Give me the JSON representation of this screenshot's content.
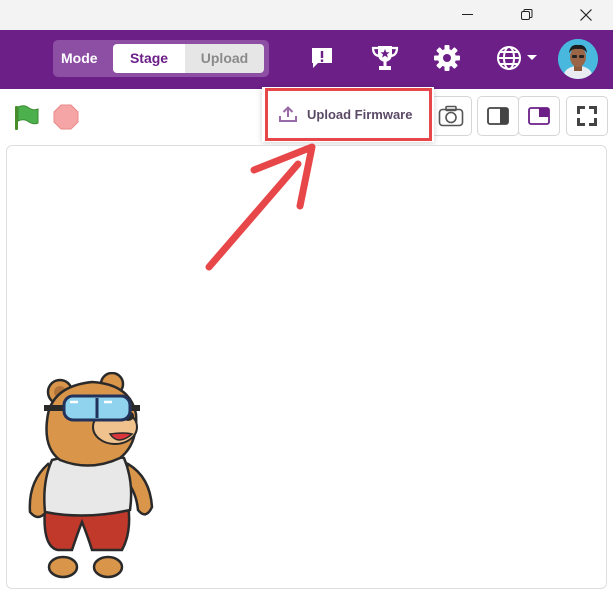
{
  "window": {
    "controls": [
      "minimize-icon",
      "restore-icon",
      "close-icon"
    ]
  },
  "header": {
    "mode_label": "Mode",
    "mode_options": [
      "Stage",
      "Upload"
    ],
    "selected_mode": "Stage",
    "icons": [
      "feedback-icon",
      "trophy-icon",
      "gear-icon",
      "globe-icon",
      "chevron-down-icon"
    ],
    "brand_color": "#6b1f87"
  },
  "toolbar": {
    "upload_firmware_label": "Upload Firmware",
    "buttons": [
      "green-flag-icon",
      "stop-icon",
      "camera-icon",
      "small-stage-icon",
      "large-stage-icon",
      "fullscreen-icon"
    ]
  },
  "annotation": {
    "highlight_color": "#e8474a"
  }
}
